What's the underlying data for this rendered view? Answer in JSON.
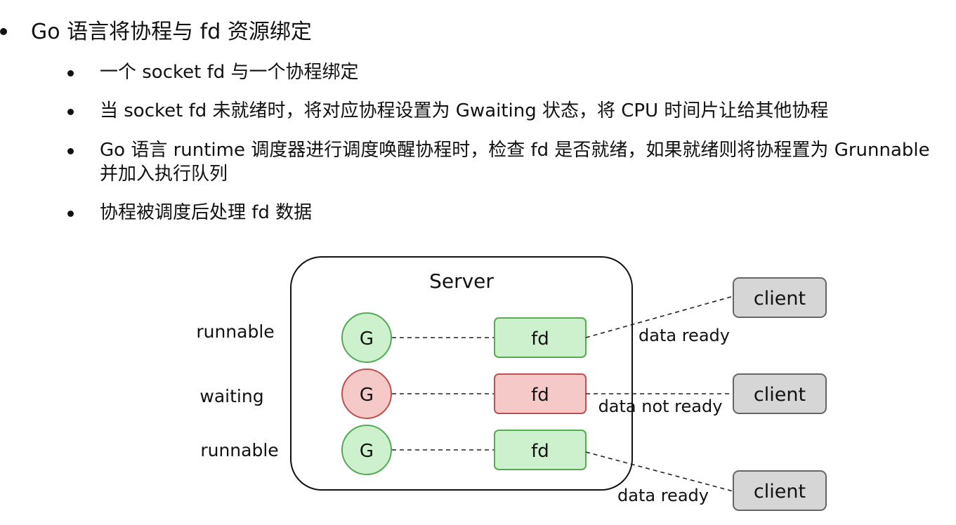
{
  "bullets": {
    "main": "Go 语言将协程与 fd 资源绑定",
    "items": [
      "一个 socket fd 与一个协程绑定",
      "当 socket fd 未就绪时，将对应协程设置为 Gwaiting 状态，将 CPU 时间片让给其他协程",
      "Go 语言 runtime 调度器进行调度唤醒协程时，检查 fd 是否就绪，如果就绪则将协程置为 Grunnable 并加入执行队列",
      "协程被调度后处理 fd 数据"
    ]
  },
  "diagram": {
    "server_label": "Server",
    "rows": [
      {
        "state_label": "runnable",
        "goroutine_label": "G",
        "fd_label": "fd",
        "client_label": "client",
        "link_label": "data ready",
        "status": "ready"
      },
      {
        "state_label": "waiting",
        "goroutine_label": "G",
        "fd_label": "fd",
        "client_label": "client",
        "link_label": "data not ready",
        "status": "not-ready"
      },
      {
        "state_label": "runnable",
        "goroutine_label": "G",
        "fd_label": "fd",
        "client_label": "client",
        "link_label": "data ready",
        "status": "ready"
      }
    ],
    "colors": {
      "ready_fill": "#cdf1cd",
      "ready_stroke": "#55aa55",
      "waiting_fill": "#f6c9c9",
      "waiting_stroke": "#c05050",
      "client_fill": "#d6d6d6",
      "client_stroke": "#666666",
      "server_stroke": "#111111"
    }
  }
}
